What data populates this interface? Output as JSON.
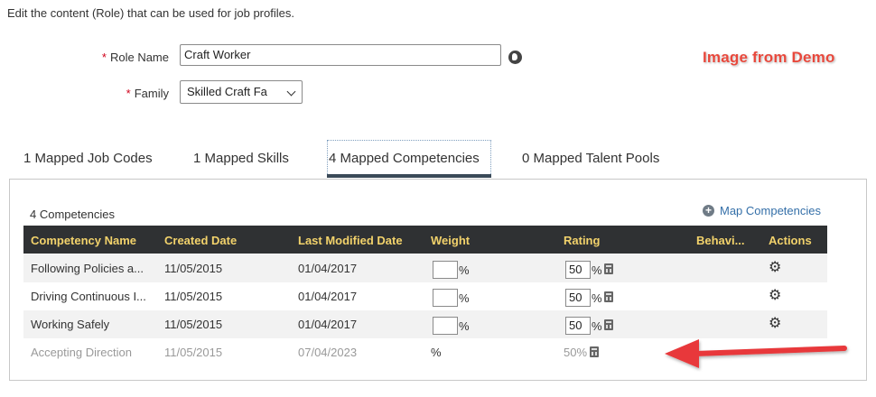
{
  "intro": "Edit the content (Role) that can be used for job profiles.",
  "form": {
    "required_mark": "*",
    "role_name_label": "Role Name",
    "role_name_value": "Craft Worker",
    "family_label": "Family",
    "family_value": "Skilled Craft Fa"
  },
  "watermark": "Image from Demo",
  "tabs": [
    {
      "label": "1 Mapped Job Codes"
    },
    {
      "label": "1 Mapped Skills"
    },
    {
      "label": "4 Mapped Competencies",
      "active": true
    },
    {
      "label": "0 Mapped Talent Pools"
    }
  ],
  "competencies": {
    "count_label": "4 Competencies",
    "map_link": "Map Competencies",
    "columns": [
      "Competency Name",
      "Created Date",
      "Last Modified Date",
      "Weight",
      "Rating",
      "Behavi...",
      "Actions"
    ],
    "rows": [
      {
        "name": "Following Policies a...",
        "created": "11/05/2015",
        "modified": "01/04/2017",
        "weight": "",
        "rating": "50",
        "pct": "%"
      },
      {
        "name": "Driving Continuous I...",
        "created": "11/05/2015",
        "modified": "01/04/2017",
        "weight": "",
        "rating": "50",
        "pct": "%"
      },
      {
        "name": "Working Safely",
        "created": "11/05/2015",
        "modified": "01/04/2017",
        "weight": "",
        "rating": "50",
        "pct": "%"
      },
      {
        "name": "Accepting Direction",
        "created": "11/05/2015",
        "modified": "07/04/2023",
        "weight": "%",
        "rating": "50%",
        "pct": "%"
      }
    ]
  },
  "colors": {
    "header_bg": "#2f3133",
    "header_text": "#f2d26b",
    "link": "#346fa8",
    "arrow": "#e8393a"
  }
}
